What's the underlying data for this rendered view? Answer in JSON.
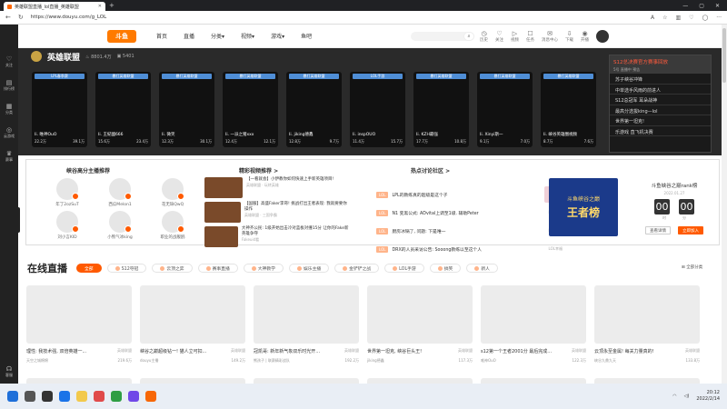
{
  "browser": {
    "tab_title": "英雄联盟直播_lol直播_英雄联盟",
    "url": "https://www.douyu.com/g_LOL"
  },
  "header": {
    "logo": "斗鱼",
    "nav": [
      "首页",
      "直播",
      "分类▾",
      "视频▾",
      "游戏▾",
      "鱼吧"
    ],
    "icons": [
      {
        "icon": "history-icon",
        "label": "历史"
      },
      {
        "icon": "follow-icon",
        "label": "关注"
      },
      {
        "icon": "video-icon",
        "label": "视频"
      },
      {
        "icon": "task-icon",
        "label": "任务"
      },
      {
        "icon": "message-icon",
        "label": "消息中心"
      },
      {
        "icon": "download-icon",
        "label": "下载"
      },
      {
        "icon": "live-icon",
        "label": "开播"
      }
    ]
  },
  "sidebar": [
    "关注",
    "排行榜",
    "分类",
    "云游戏",
    "赛事"
  ],
  "sidebar_bottom": "客服",
  "game": {
    "name": "英雄联盟",
    "stat1": "8801.4万",
    "stat2": "5401"
  },
  "cards": [
    {
      "tag": "LPL春季赛",
      "name": "Ii. 唯神OuO",
      "left": "22.2万",
      "right": "39.1万"
    },
    {
      "tag": "暴打英雄联盟",
      "name": "Ii. 王紀國666",
      "left": "15.6万",
      "right": "23.4万"
    },
    {
      "tag": "暴打英雄联盟",
      "name": "Ii. 微笑",
      "left": "12.3万",
      "right": "30.1万"
    },
    {
      "tag": "暴打英雄联盟",
      "name": "Ii. 一派之猪xxx",
      "left": "12.4万",
      "right": "12.1万"
    },
    {
      "tag": "暴打英雄联盟",
      "name": "Ii. jiking德鑫",
      "left": "12.8万",
      "right": "9.7万"
    },
    {
      "tag": "LOL手游",
      "name": "Ii. inspOUO",
      "left": "11.4万",
      "right": "15.7万"
    },
    {
      "tag": "暴打英雄联盟",
      "name": "Ii. KZH最强",
      "left": "17.7万",
      "right": "10.8万"
    },
    {
      "tag": "暴打英雄联盟",
      "name": "Ii. Xinyi斯一",
      "left": "9.1万",
      "right": "7.0万"
    },
    {
      "tag": "暴打英雄联盟",
      "name": "Ii. 峡谷英雄圈视频",
      "left": "8.7万",
      "right": "7.6万"
    }
  ],
  "events": {
    "title": "S12总决赛官方赛事回放",
    "subtitle": "5号 直播中 预告",
    "items": [
      "苏子峡谷冲锋",
      "中单选手风雨的前进人",
      "S12总冠军 耳朵战神",
      "最高分选拔king—lol",
      "世界第一坦克!",
      "乐游戏 直飞机决赛"
    ]
  },
  "panel": {
    "streamers_title": "峡谷高分主播推荐",
    "streamers": [
      "年丁2ozSuT",
      "西瓜Melon1",
      "花无缺QwQ",
      "刘小言KID",
      "小熊气冰king",
      "职业的战舰鸥"
    ],
    "videos_title": "精彩视频推荐 >",
    "videos": [
      {
        "t": "【一看就会】小伊教你如何快速上手新英雄项目!",
        "s": "英雄联盟 · 玩转英雄"
      },
      {
        "t": "【国服】高盛Faker李哥! 挑战打出王者表现: 我就要要你操作",
        "s": "英雄联盟 · 三国争霸"
      },
      {
        "t": "大神齐公民: 1级开始出击冷对蓝板对撞15分 让你的Fake新英雄争夺",
        "s": "Fakeuid看"
      }
    ],
    "topics_title": "热点讨论社区 >",
    "topics": [
      {
        "t": "LPL的教练真的超级是这个子",
        "r": ""
      },
      {
        "t": "N1 变黑公式: ADvital上调至1级. 辅助Peter",
        "r": "LOL幸福"
      },
      {
        "t": "厨房冰锅了, 问题: 下是唯一",
        "r": "LOL幸福"
      },
      {
        "t": "DRX的人员采访公告: Sooong教练以至这个人",
        "r": "LOL幸福"
      }
    ],
    "rank_line1": "斗鱼峡谷之巅",
    "rank_line2": "王者榜",
    "countdown_title": "斗鱼峡谷之巅rank榜",
    "countdown_date": "2022.01.27",
    "digits": [
      "00",
      "00"
    ],
    "digit_labels": [
      "时",
      "分"
    ],
    "btn1": "查看详情",
    "btn2": "立即加入"
  },
  "live": {
    "title": "在线直播",
    "filters": [
      "全部",
      "S12夺冠",
      "云顶之弈",
      "赛事直播",
      "大神教学",
      "娱乐主播",
      "金铲铲之战",
      "LOL手游",
      "搞笑",
      "新人"
    ],
    "all_categories": "全部分类"
  },
  "streams": [
    {
      "t": "理性: 我技术强, 双倍英雄一...",
      "c": "英雄联盟",
      "who": "天空之城棉棉",
      "v": "219.6万"
    },
    {
      "t": "峡谷之巅超级钻一! 猫人立可扣...",
      "c": "英雄联盟",
      "who": "douyu主播",
      "v": "149.2万"
    },
    {
      "t": "冠凯哥: 新年新气象双乐时光开...",
      "c": "英雄联盟",
      "who": "熊孩子 | 联赛精彩战队",
      "v": "192.2万"
    },
    {
      "t": "世界第一坦克, 峡谷巨头王!",
      "c": "英雄联盟",
      "who": "jiking德鑫",
      "v": "117.3万"
    },
    {
      "t": "s12第一个王者2001分 最后完成...",
      "c": "英雄联盟",
      "who": "唯神OuO",
      "v": "122.3万"
    },
    {
      "t": "云顶永至金属! 每关力量真的!",
      "c": "英雄联盟",
      "who": "峡谷九鼎九天",
      "v": "133.8万"
    }
  ],
  "taskbar": {
    "time": "20:12",
    "date": "2022/2/14"
  }
}
